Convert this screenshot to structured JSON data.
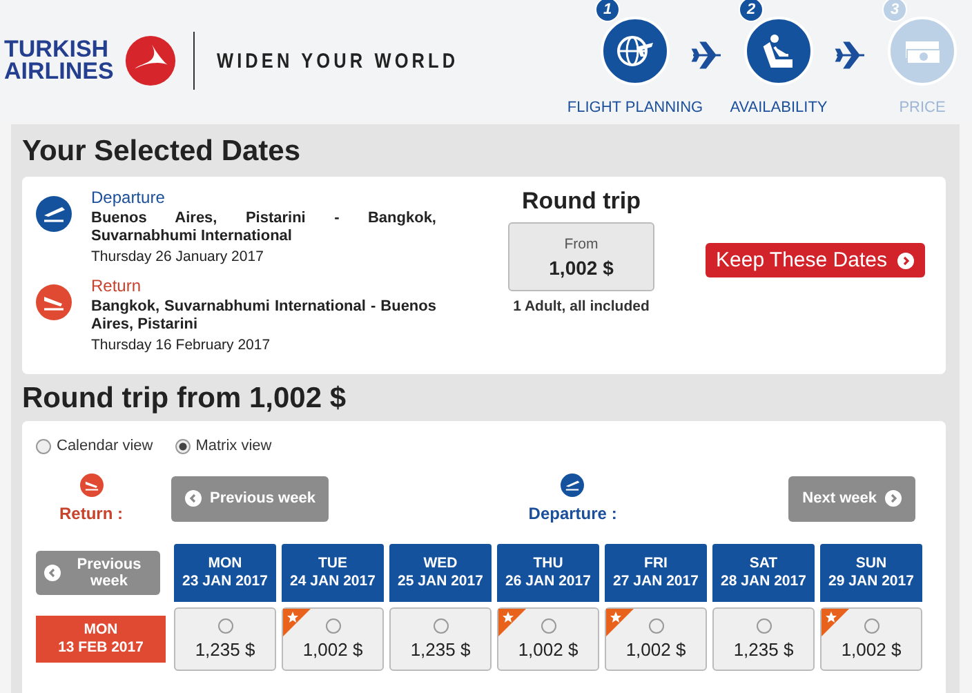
{
  "header": {
    "brand": "TURKISH AIRLINES",
    "slogan": "WIDEN YOUR WORLD",
    "steps": [
      {
        "number": "1",
        "label": "FLIGHT PLANNING",
        "done": true,
        "kind": "globe"
      },
      {
        "number": "2",
        "label": "AVAILABILITY",
        "done": true,
        "kind": "seat"
      },
      {
        "number": "3",
        "label": "PRICE",
        "done": false,
        "kind": "money"
      }
    ]
  },
  "selected_dates": {
    "title": "Your Selected Dates",
    "legs": [
      {
        "kind": "departure",
        "label": "Departure",
        "route": "Buenos Aires, Pistarini - Bangkok, Suvarnabhumi International",
        "date": "Thursday 26 January 2017"
      },
      {
        "kind": "return",
        "label": "Return",
        "route": "Bangkok, Suvarnabhumi International - Buenos Aires, Pistarini",
        "date": "Thursday 16 February 2017"
      }
    ],
    "trip_type": "Round trip",
    "price_label": "From",
    "price": "1,002 $",
    "note": "1 Adult, all included",
    "button": "Keep These Dates"
  },
  "matrix": {
    "title": "Round trip from 1,002 $",
    "views": [
      {
        "label": "Calendar view",
        "selected": false
      },
      {
        "label": "Matrix view",
        "selected": true
      }
    ],
    "return_label": "Return :",
    "departure_label": "Departure :",
    "prev_week": "Previous week",
    "next_week": "Next week",
    "prev_week_return": "Previous week",
    "columns": [
      {
        "day": "MON",
        "date": "23 JAN 2017"
      },
      {
        "day": "TUE",
        "date": "24 JAN 2017"
      },
      {
        "day": "WED",
        "date": "25 JAN 2017"
      },
      {
        "day": "THU",
        "date": "26 JAN 2017"
      },
      {
        "day": "FRI",
        "date": "27 JAN 2017"
      },
      {
        "day": "SAT",
        "date": "28 JAN 2017"
      },
      {
        "day": "SUN",
        "date": "29 JAN 2017"
      }
    ],
    "rows": [
      {
        "day": "MON",
        "date": "13 FEB 2017",
        "cells": [
          {
            "price": "1,235 $",
            "best": false,
            "selected": false
          },
          {
            "price": "1,002 $",
            "best": true,
            "selected": false
          },
          {
            "price": "1,235 $",
            "best": false,
            "selected": false
          },
          {
            "price": "1,002 $",
            "best": true,
            "selected": false
          },
          {
            "price": "1,002 $",
            "best": true,
            "selected": false
          },
          {
            "price": "1,235 $",
            "best": false,
            "selected": false
          },
          {
            "price": "1,002 $",
            "best": true,
            "selected": false
          }
        ]
      }
    ]
  }
}
